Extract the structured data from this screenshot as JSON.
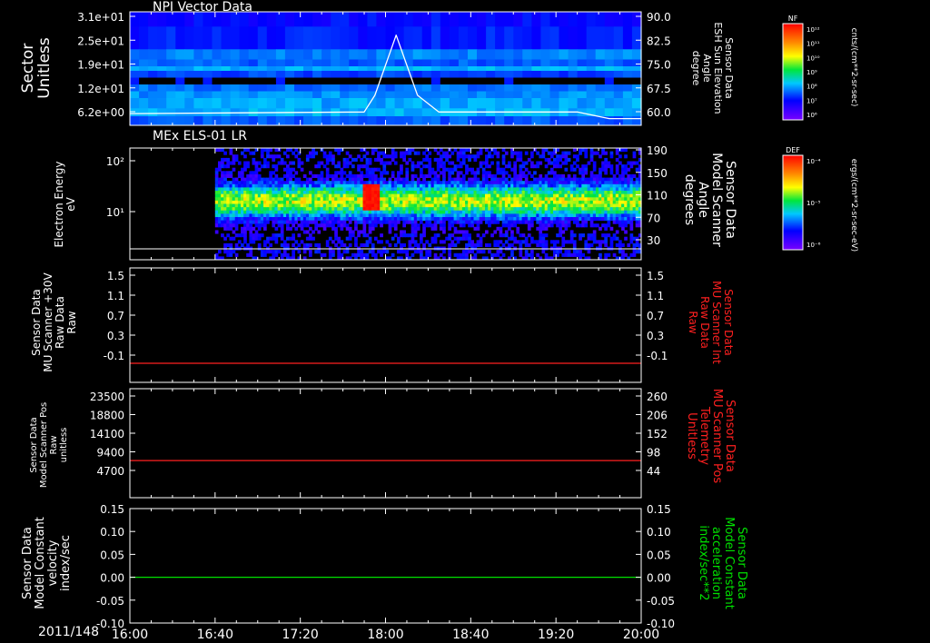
{
  "date_label": "2011/148",
  "panels": [
    {
      "title": "NPI Vector Data",
      "left_label": "Sector\nUnitless",
      "right_label": "Sensor Data\nESH Sun Elevation\nAngle\ndegree",
      "right_color": "#ffffff",
      "left_color": "#ffffff"
    },
    {
      "title": "MEx ELS-01 LR",
      "left_label": "Electron Energy\neV",
      "right_label": "Sensor Data\nModel Scanner\nAngle\ndegrees",
      "right_color": "#ffffff",
      "left_color": "#ffffff"
    },
    {
      "title": "",
      "left_label": "Sensor Data\nMU Scanner +30V\nRaw Data\nRaw",
      "right_label": "Sensor Data\nMU Scanner Int\nRaw Data\nRaw",
      "right_color": "#ff2020",
      "left_color": "#ffffff"
    },
    {
      "title": "",
      "left_label": "Sensor Data\nModel Scanner Pos\nRaw\nunitless",
      "right_label": "Sensor Data\nMU Scanner Pos\nTelemetry\nUnitless",
      "right_color": "#ff2020",
      "left_color": "#ffffff"
    },
    {
      "title": "",
      "left_label": "Sensor Data\nModel Constant\nvelocity\nindex/sec",
      "right_label": "Sensor Data\nModel Constant\nacceleration\nindex/sec**2",
      "right_color": "#00e000",
      "left_color": "#ffffff"
    }
  ],
  "colorbars": [
    {
      "label": "NF",
      "unit": "cnts/(cm**2-sr-sec)",
      "ticks": [
        "10¹²",
        "10¹¹",
        "10¹⁰",
        "10⁹",
        "10⁸",
        "10⁷",
        "10⁶"
      ]
    },
    {
      "label": "DEF",
      "unit": "ergs/(cm**2-sr-sec-eV)",
      "ticks": [
        "10⁻⁴",
        "10⁻⁵",
        "10⁻⁶"
      ]
    }
  ],
  "chart_data": [
    {
      "type": "heatmap",
      "title": "NPI Vector Data",
      "x_ticks": [
        "16:00",
        "16:40",
        "17:20",
        "18:00",
        "18:40",
        "19:20",
        "20:00"
      ],
      "y_left_ticks": [
        "3.1e+01",
        "2.5e+01",
        "1.9e+01",
        "1.2e+01",
        "6.2e+00"
      ],
      "y_right_ticks": [
        "90.0",
        "82.5",
        "75.0",
        "67.5",
        "60.0"
      ],
      "overlay_line": {
        "name": "ESH Sun Elevation Angle",
        "x": [
          "16:00",
          "17:50",
          "17:55",
          "18:05",
          "18:15",
          "18:25",
          "19:30",
          "19:45",
          "20:00"
        ],
        "y": [
          59.5,
          60.0,
          65.0,
          83.0,
          65.0,
          60.0,
          60.0,
          58.0,
          58.0
        ],
        "ylim": [
          56,
          90
        ]
      }
    },
    {
      "type": "heatmap",
      "title": "MEx ELS-01 LR",
      "y_left_ticks": [
        "10²",
        "10¹"
      ],
      "y_right_ticks": [
        "190",
        "150",
        "110",
        "70",
        "30"
      ],
      "data_start": "16:40",
      "hot_spot": "17:53",
      "overlay_line": {
        "name": "Model Scanner Angle",
        "y": 2,
        "ylim": [
          0,
          190
        ]
      }
    },
    {
      "type": "line",
      "ylim": [
        -0.3,
        1.5
      ],
      "y_left_ticks": [
        "1.5",
        "1.1",
        "0.7",
        "0.3",
        "-0.1"
      ],
      "y_right_ticks": [
        "1.5",
        "1.1",
        "0.7",
        "0.3",
        "-0.1"
      ],
      "series": [
        {
          "name": "MU Scanner Int Raw Data",
          "value": 0.0,
          "color": "#ff2020"
        }
      ]
    },
    {
      "type": "line",
      "ylim": [
        0,
        23500
      ],
      "y_left_ticks": [
        "23500",
        "18800",
        "14100",
        "9400",
        "4700"
      ],
      "y_right_ticks": [
        "260",
        "206",
        "152",
        "98",
        "44"
      ],
      "series": [
        {
          "name": "MU Scanner Pos Telemetry",
          "value": 8000,
          "color": "#ff2020"
        }
      ]
    },
    {
      "type": "line",
      "ylim": [
        -0.1,
        0.15
      ],
      "y_left_ticks": [
        "0.15",
        "0.10",
        "0.05",
        "0.00",
        "-0.05",
        "-0.10"
      ],
      "y_right_ticks": [
        "0.15",
        "0.10",
        "0.05",
        "0.00",
        "-0.05",
        "-0.10"
      ],
      "series": [
        {
          "name": "Model Constant acceleration",
          "value": 0.0,
          "color": "#00e000"
        }
      ]
    }
  ]
}
